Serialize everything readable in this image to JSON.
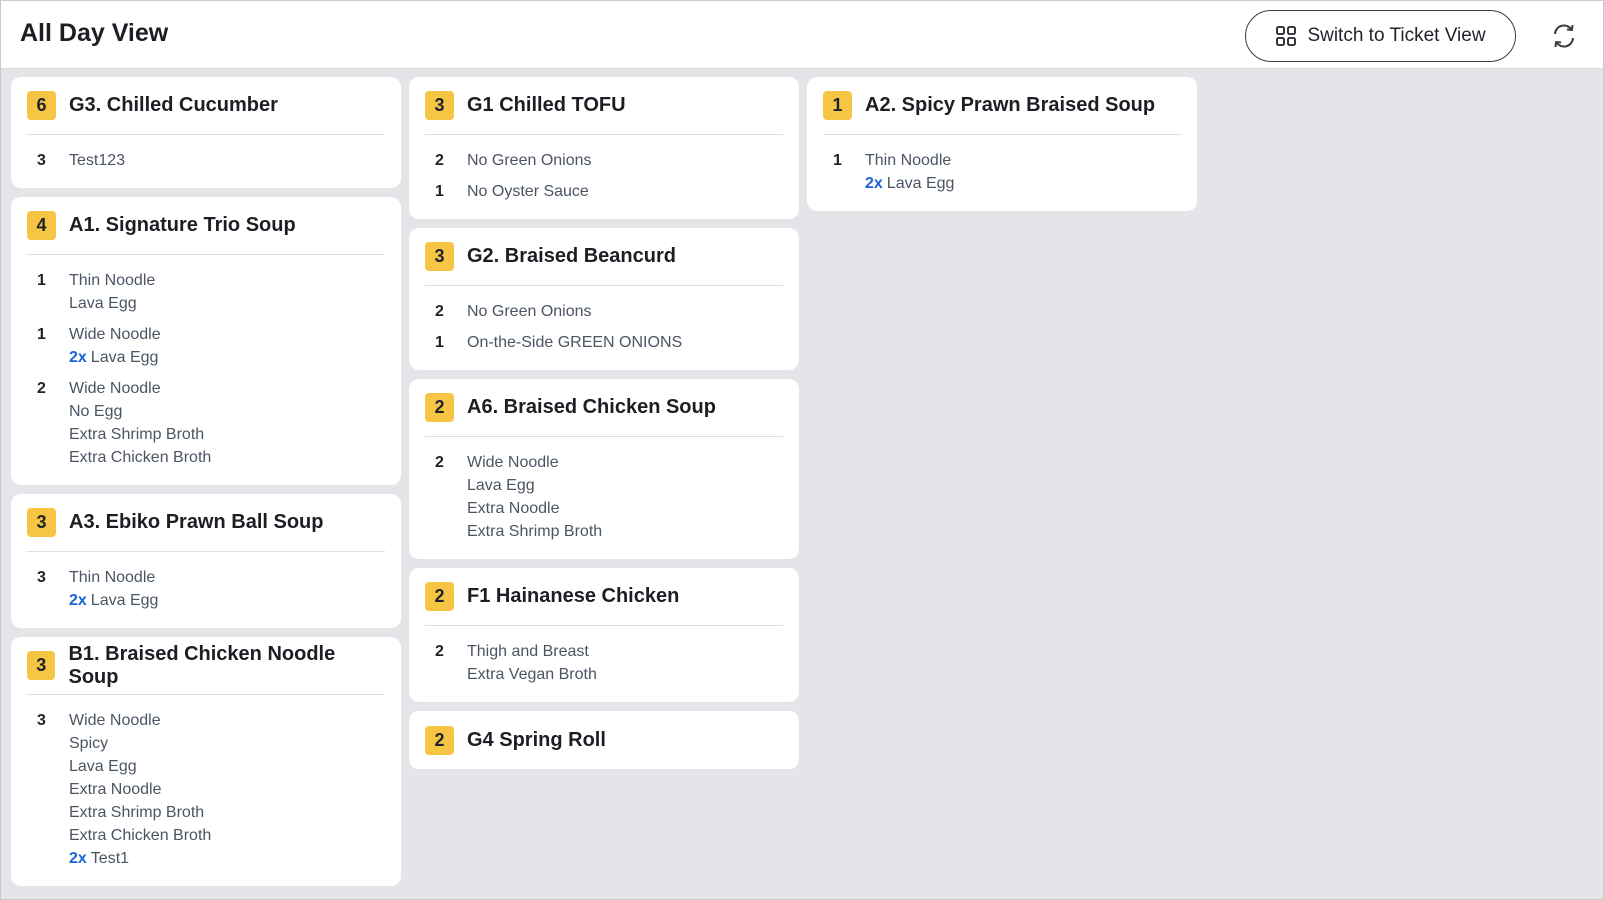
{
  "header": {
    "title": "All Day View",
    "switch_label": "Switch to Ticket View",
    "grid_icon": "grid-icon",
    "refresh_icon": "refresh-icon"
  },
  "colors": {
    "badge": "#f6c544",
    "multiplier": "#1a63d8"
  },
  "columns": [
    [
      {
        "qty": "6",
        "name": "G3. Chilled Cucumber",
        "groups": [
          {
            "qty": "3",
            "lines": [
              {
                "mult": "",
                "text": "Test123"
              }
            ]
          }
        ]
      },
      {
        "qty": "4",
        "name": "A1. Signature Trio Soup",
        "groups": [
          {
            "qty": "1",
            "lines": [
              {
                "mult": "",
                "text": "Thin Noodle"
              },
              {
                "mult": "",
                "text": "Lava Egg"
              }
            ]
          },
          {
            "qty": "1",
            "lines": [
              {
                "mult": "",
                "text": "Wide Noodle"
              },
              {
                "mult": "2x",
                "text": "Lava Egg"
              }
            ]
          },
          {
            "qty": "2",
            "lines": [
              {
                "mult": "",
                "text": "Wide Noodle"
              },
              {
                "mult": "",
                "text": "No Egg"
              },
              {
                "mult": "",
                "text": "Extra Shrimp Broth"
              },
              {
                "mult": "",
                "text": "Extra Chicken Broth"
              }
            ]
          }
        ]
      },
      {
        "qty": "3",
        "name": "A3. Ebiko Prawn Ball Soup",
        "groups": [
          {
            "qty": "3",
            "lines": [
              {
                "mult": "",
                "text": "Thin Noodle"
              },
              {
                "mult": "2x",
                "text": "Lava Egg"
              }
            ]
          }
        ]
      },
      {
        "qty": "3",
        "name": "B1. Braised Chicken Noodle Soup",
        "groups": [
          {
            "qty": "3",
            "lines": [
              {
                "mult": "",
                "text": "Wide Noodle"
              },
              {
                "mult": "",
                "text": "Spicy"
              },
              {
                "mult": "",
                "text": "Lava Egg"
              },
              {
                "mult": "",
                "text": "Extra Noodle"
              },
              {
                "mult": "",
                "text": "Extra Shrimp Broth"
              },
              {
                "mult": "",
                "text": "Extra Chicken Broth"
              },
              {
                "mult": "2x",
                "text": "Test1"
              }
            ]
          }
        ]
      }
    ],
    [
      {
        "qty": "3",
        "name": "G1 Chilled TOFU",
        "groups": [
          {
            "qty": "2",
            "lines": [
              {
                "mult": "",
                "text": "No Green Onions"
              }
            ]
          },
          {
            "qty": "1",
            "lines": [
              {
                "mult": "",
                "text": "No Oyster Sauce"
              }
            ]
          }
        ]
      },
      {
        "qty": "3",
        "name": "G2. Braised Beancurd",
        "groups": [
          {
            "qty": "2",
            "lines": [
              {
                "mult": "",
                "text": "No Green Onions"
              }
            ]
          },
          {
            "qty": "1",
            "lines": [
              {
                "mult": "",
                "text": "On-the-Side GREEN ONIONS"
              }
            ]
          }
        ]
      },
      {
        "qty": "2",
        "name": "A6. Braised Chicken Soup",
        "groups": [
          {
            "qty": "2",
            "lines": [
              {
                "mult": "",
                "text": "Wide Noodle"
              },
              {
                "mult": "",
                "text": "Lava Egg"
              },
              {
                "mult": "",
                "text": "Extra Noodle"
              },
              {
                "mult": "",
                "text": "Extra Shrimp Broth"
              }
            ]
          }
        ]
      },
      {
        "qty": "2",
        "name": "F1 Hainanese Chicken",
        "groups": [
          {
            "qty": "2",
            "lines": [
              {
                "mult": "",
                "text": "Thigh and Breast"
              },
              {
                "mult": "",
                "text": "Extra Vegan Broth"
              }
            ]
          }
        ]
      },
      {
        "qty": "2",
        "name": "G4 Spring Roll",
        "groups": []
      }
    ],
    [
      {
        "qty": "1",
        "name": "A2. Spicy Prawn Braised Soup",
        "groups": [
          {
            "qty": "1",
            "lines": [
              {
                "mult": "",
                "text": "Thin Noodle"
              },
              {
                "mult": "2x",
                "text": "Lava Egg"
              }
            ]
          }
        ]
      }
    ]
  ]
}
